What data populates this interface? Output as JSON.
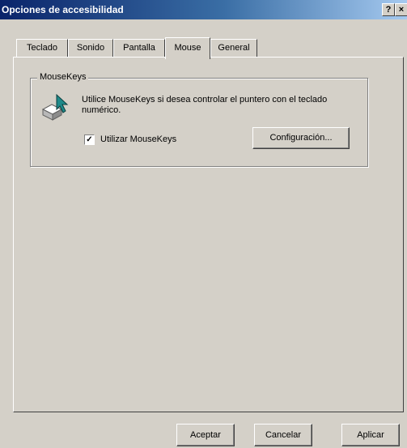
{
  "window": {
    "title": "Opciones de accesibilidad",
    "help_glyph": "?",
    "close_glyph": "×"
  },
  "tabs": [
    {
      "label": "Teclado",
      "active": false
    },
    {
      "label": "Sonido",
      "active": false
    },
    {
      "label": "Pantalla",
      "active": false
    },
    {
      "label": "Mouse",
      "active": true
    },
    {
      "label": "General",
      "active": false
    }
  ],
  "mousekeys": {
    "group_title": "MouseKeys",
    "description": "Utilice MouseKeys si desea controlar el puntero con el teclado numérico.",
    "icon": "mousekeys-icon",
    "checkbox_label": "Utilizar MouseKeys",
    "checkbox_checked": true,
    "checkbox_mark": "✓",
    "settings_button": "Configuración..."
  },
  "footer": {
    "ok": "Aceptar",
    "cancel": "Cancelar",
    "apply": "Aplicar"
  }
}
